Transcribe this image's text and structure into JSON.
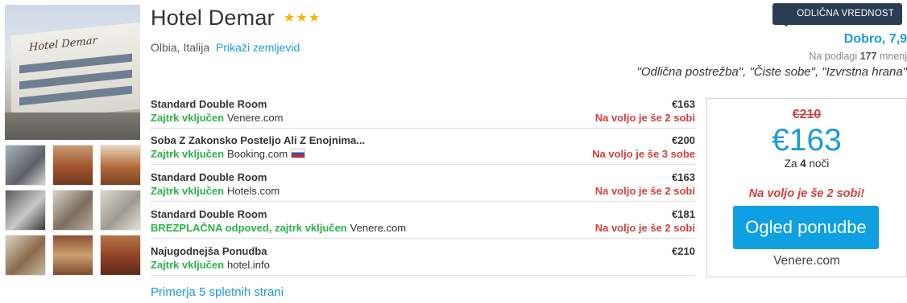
{
  "hotel": {
    "name": "Hotel Demar",
    "stars": "★★★",
    "location": "Olbia, Italija",
    "map_link": "Prikaži zemljevid",
    "photo_sign": "Hotel Demar"
  },
  "rating": {
    "badge": "ODLIČNA VREDNOST",
    "score": "Dobro, 7,9",
    "count_prefix": "Na podlagi",
    "count": "177",
    "count_suffix": "mnenj",
    "quotes": "\"Odlična postrežba\", \"Čiste sobe\", \"Izvrstna hrana\""
  },
  "offers": [
    {
      "room": "Standard Double Room",
      "meal": "Zajtrk vključen",
      "site": "Venere.com",
      "price": "€163",
      "availability": "Na voljo je še 2 sobi"
    },
    {
      "room": "Soba Z Zakonsko Posteljo Ali Z Enojnima...",
      "meal": "Zajtrk vključen",
      "site": "Booking.com",
      "price": "€200",
      "availability": "Na voljo je še 3 sobe"
    },
    {
      "room": "Standard Double Room",
      "meal": "Zajtrk vključen",
      "site": "Hotels.com",
      "price": "€163",
      "availability": "Na voljo je še 2 sobi"
    },
    {
      "room": "Standard Double Room",
      "meal": "BREZPLAČNA odpoved, zajtrk vključen",
      "site": "Venere.com",
      "price": "€181",
      "availability": "Na voljo je še 2 sobi"
    },
    {
      "room": "Najugodnejša Ponudba",
      "meal": "Zajtrk vključen",
      "site": "hotel.info",
      "price": "€210",
      "availability": ""
    }
  ],
  "compare_link": "Primerja 5 spletnih strani",
  "deal": {
    "old_price": "€210",
    "new_price": "€163",
    "nights_prefix": "Za",
    "nights": "4",
    "nights_suffix": "noči",
    "availability": "Na voljo je še 2 sobi!",
    "button": "Ogled ponudbe",
    "site": "Venere.com"
  },
  "colors": {
    "accent": "#1a9cd8",
    "green": "#2ab34a",
    "red": "#d23f3f",
    "badge": "#2a3d52",
    "button": "#0fa0e3",
    "star": "#f2b600"
  },
  "icons": {
    "badge": "checkmark-seal-icon",
    "flag": "slovenia-flag-icon"
  }
}
